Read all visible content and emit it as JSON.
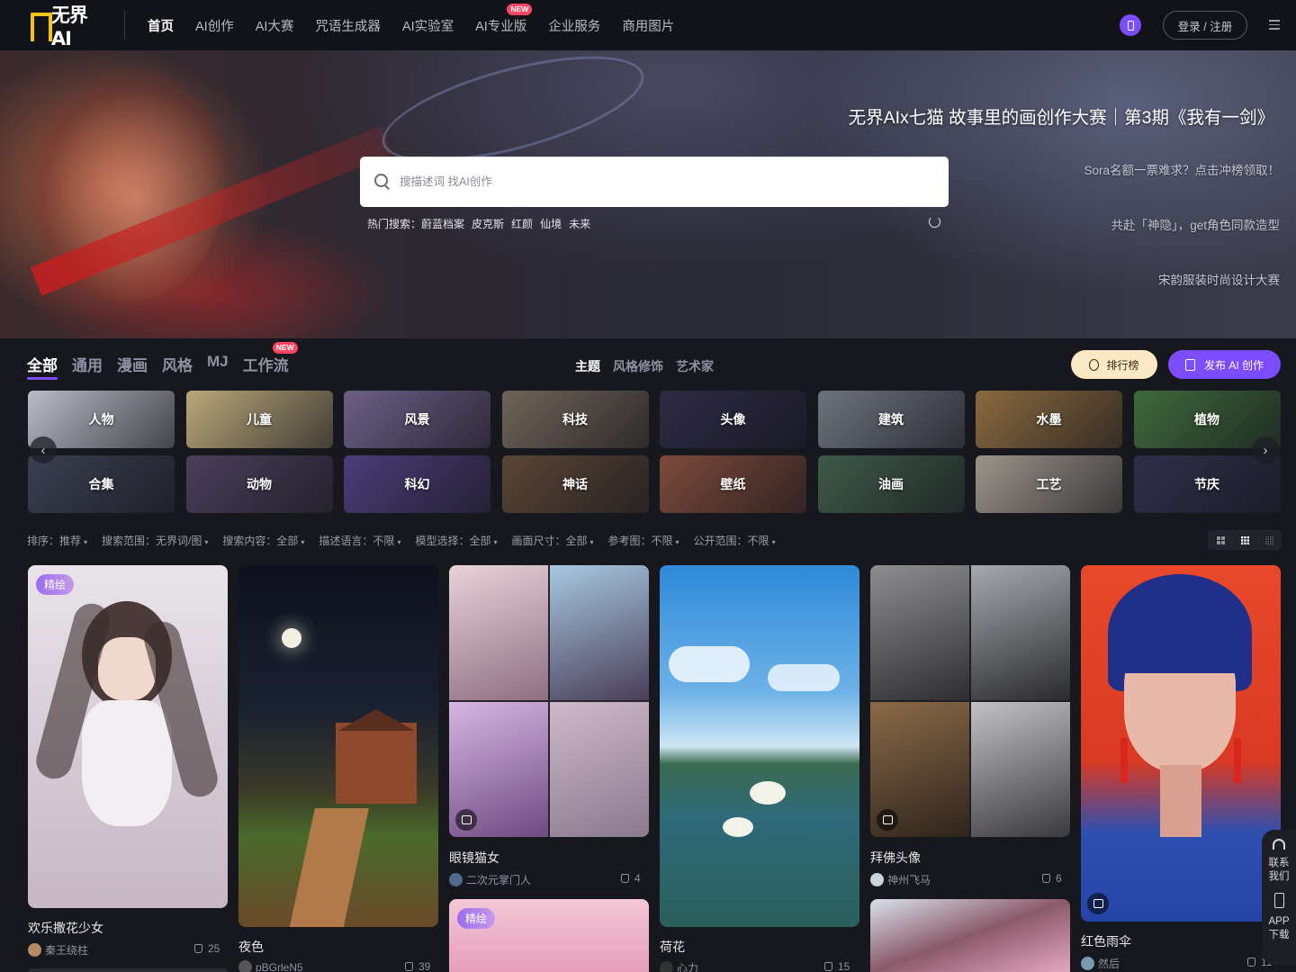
{
  "nav": {
    "logo_text": "无界AI",
    "items": [
      {
        "label": "首页",
        "active": true
      },
      {
        "label": "AI创作"
      },
      {
        "label": "AI大赛"
      },
      {
        "label": "咒语生成器"
      },
      {
        "label": "AI实验室"
      },
      {
        "label": "AI专业版",
        "badge": "NEW"
      },
      {
        "label": "企业服务"
      },
      {
        "label": "商用图片"
      }
    ],
    "login_label": "登录 / 注册"
  },
  "hero": {
    "title": "无界AIx七猫 故事里的画创作大赛｜第3期《我有一剑》",
    "links": [
      "Sora名额一票难求？点击冲榜领取！",
      "共赴「神隐」，get角色同款造型",
      "宋韵服装时尚设计大赛"
    ],
    "search_placeholder": "搜描述词 找AI创作",
    "hot_label": "热门搜索：",
    "hot_items": [
      "蔚蓝档案",
      "皮克斯",
      "红颜",
      "仙境",
      "未来"
    ]
  },
  "categories": {
    "tabs": [
      {
        "label": "全部",
        "active": true
      },
      {
        "label": "通用"
      },
      {
        "label": "漫画"
      },
      {
        "label": "风格"
      },
      {
        "label": "MJ"
      },
      {
        "label": "工作流",
        "badge": "NEW"
      }
    ],
    "sub_tabs": [
      {
        "label": "主题",
        "active": true
      },
      {
        "label": "风格修饰"
      },
      {
        "label": "艺术家"
      }
    ],
    "rank_label": "排行榜",
    "publish_label": "发布 AI 创作"
  },
  "themes": [
    {
      "label": "人物",
      "color": "#b9bcc6"
    },
    {
      "label": "儿童",
      "color": "#b9a879"
    },
    {
      "label": "风景",
      "color": "#6c5f86"
    },
    {
      "label": "科技",
      "color": "#6f6458"
    },
    {
      "label": "头像",
      "color": "#2d2a44"
    },
    {
      "label": "建筑",
      "color": "#6d737e"
    },
    {
      "label": "水墨",
      "color": "#8a6a3e"
    },
    {
      "label": "植物",
      "color": "#3f6a3c"
    },
    {
      "label": "合集",
      "color": "#3a4050"
    },
    {
      "label": "动物",
      "color": "#4a3f5a"
    },
    {
      "label": "科幻",
      "color": "#4b3d78"
    },
    {
      "label": "神话",
      "color": "#5a4636"
    },
    {
      "label": "壁纸",
      "color": "#7c4a3a"
    },
    {
      "label": "油画",
      "color": "#3e5a48"
    },
    {
      "label": "工艺",
      "color": "#9c948a"
    },
    {
      "label": "节庆",
      "color": "#2f2f4a"
    }
  ],
  "filters": [
    "排序：推荐",
    "搜索范围：无界词/图",
    "搜索内容：全部",
    "描述语言：不限",
    "模型选择：全部",
    "画面尺寸：全部",
    "参考图：不限",
    "公开范围：不限"
  ],
  "cards": [
    {
      "title": "欢乐撒花少女",
      "author": "秦王绕柱",
      "likes": "25",
      "tag": "精绘"
    },
    {
      "title": "夜色",
      "author": "pBGrleN5",
      "likes": "39"
    },
    {
      "title": "眼镜猫女",
      "author": "二次元掌门人",
      "likes": "4"
    },
    {
      "title": "荷花",
      "author": "心力",
      "likes": "15"
    },
    {
      "title": "拜佛头像",
      "author": "神州飞马",
      "likes": "6"
    },
    {
      "title": "红色雨伞",
      "author": "然后",
      "likes": "11"
    },
    {
      "tag": "精绘"
    }
  ],
  "side": {
    "contact": "联系我们",
    "app": "APP下载"
  },
  "colors": {
    "accent": "#7c4dff",
    "background": "#17181d",
    "new_badge": "#ff4664"
  }
}
